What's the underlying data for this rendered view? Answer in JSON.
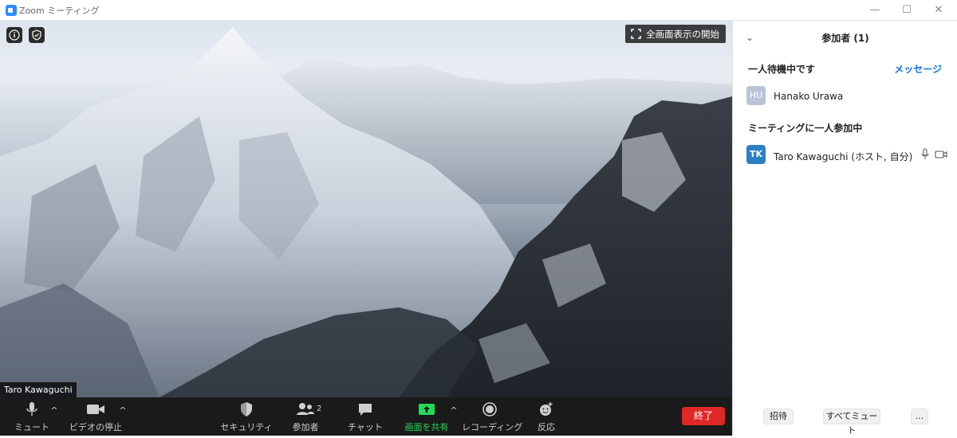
{
  "window": {
    "title": "Zoom ミーティング",
    "minimize": "—",
    "maximize": "☐",
    "close": "✕"
  },
  "video": {
    "fullscreen_label": "全画面表示の開始",
    "name_tag": "Taro Kawaguchi"
  },
  "toolbar": {
    "mute": "ミュート",
    "stop_video": "ビデオの停止",
    "security": "セキュリティ",
    "participants": "参加者",
    "participants_count": "2",
    "chat": "チャット",
    "share_screen": "画面を共有",
    "recording": "レコーディング",
    "reactions": "反応",
    "end": "終了",
    "share_color": "#23d959",
    "end_color": "#e02828"
  },
  "panel": {
    "title": "参加者 (1)",
    "waiting_header": "一人待機中です",
    "message_link": "メッセージ",
    "waiting_participant": {
      "initials": "HU",
      "name": "Hanako Urawa"
    },
    "in_meeting_header": "ミーティングに一人参加中",
    "in_meeting_participant": {
      "initials": "TK",
      "name": "Taro Kawaguchi (ホスト, 自分)"
    },
    "footer": {
      "invite": "招待",
      "mute_all": "すべてミュート",
      "more": "..."
    }
  },
  "icons": {
    "info": "info-icon",
    "shield": "shield-icon",
    "fullscreen": "fullscreen-icon",
    "mic": "mic-icon",
    "camera": "camera-icon",
    "participants": "people-icon",
    "chat": "chat-icon",
    "share": "share-screen-icon",
    "record": "record-icon",
    "reaction": "reaction-icon"
  },
  "colors": {
    "accent": "#0e71eb",
    "waiting_avatar": "#b9c4d6",
    "host_avatar": "#2d7fc4"
  }
}
